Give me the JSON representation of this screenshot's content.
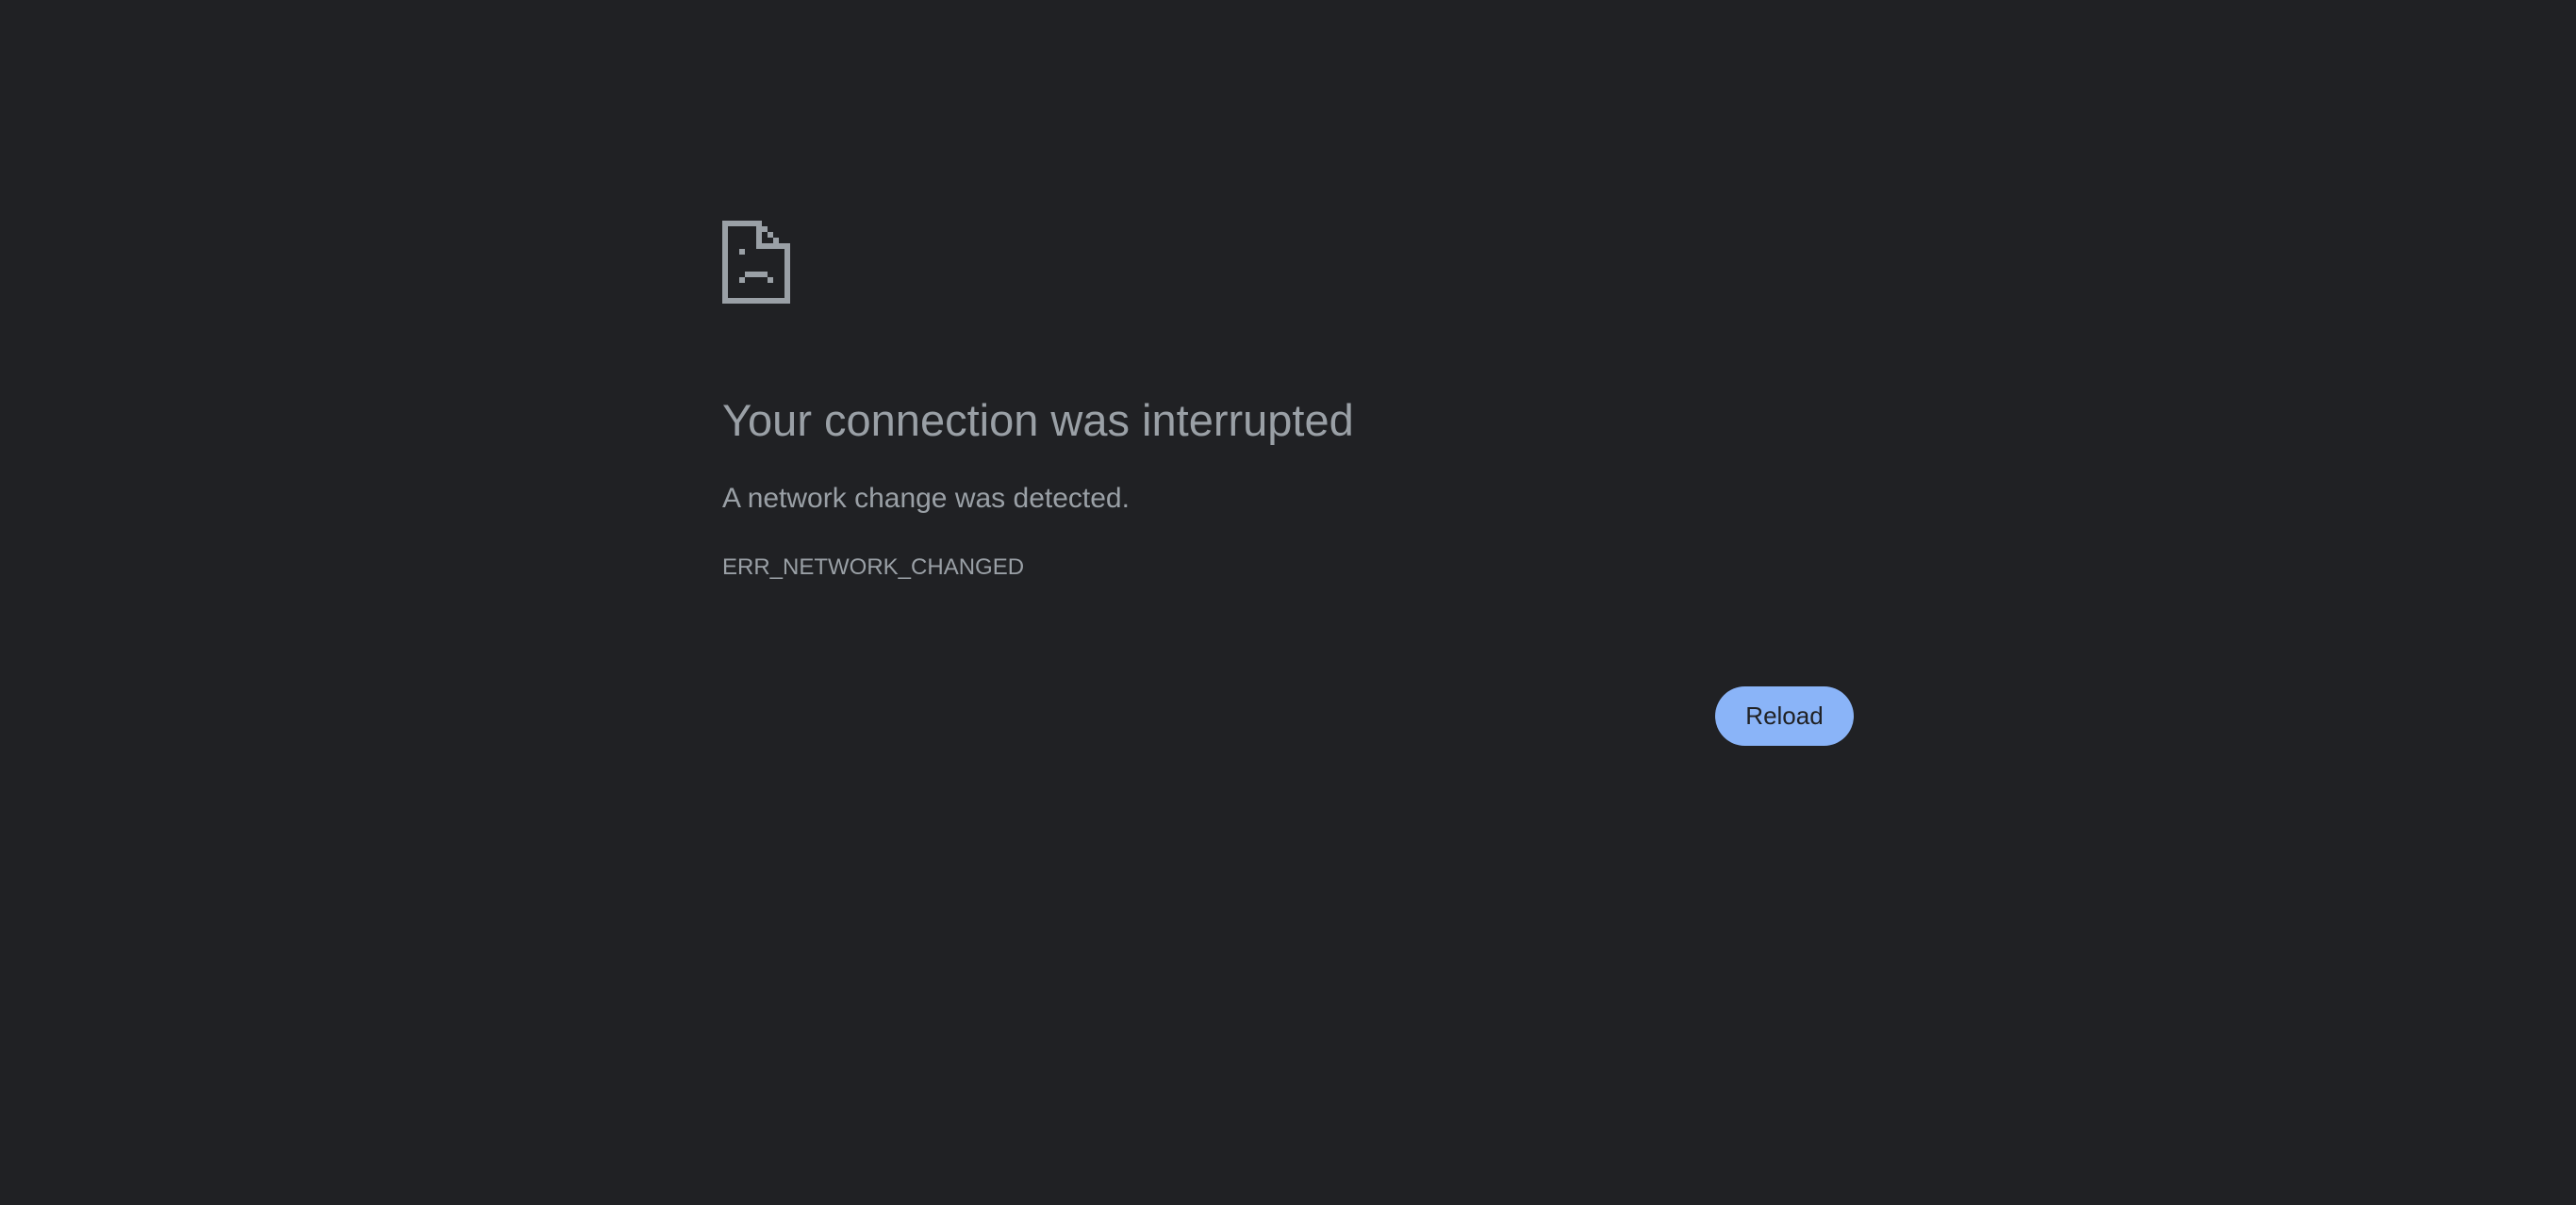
{
  "icon": "sad-page-icon",
  "title": "Your connection was interrupted",
  "summary": "A network change was detected.",
  "error_code": "ERR_NETWORK_CHANGED",
  "reload_label": "Reload",
  "colors": {
    "background": "#202124",
    "text": "#9aa0a6",
    "button_bg": "#8ab4f8",
    "button_text": "#202124"
  }
}
